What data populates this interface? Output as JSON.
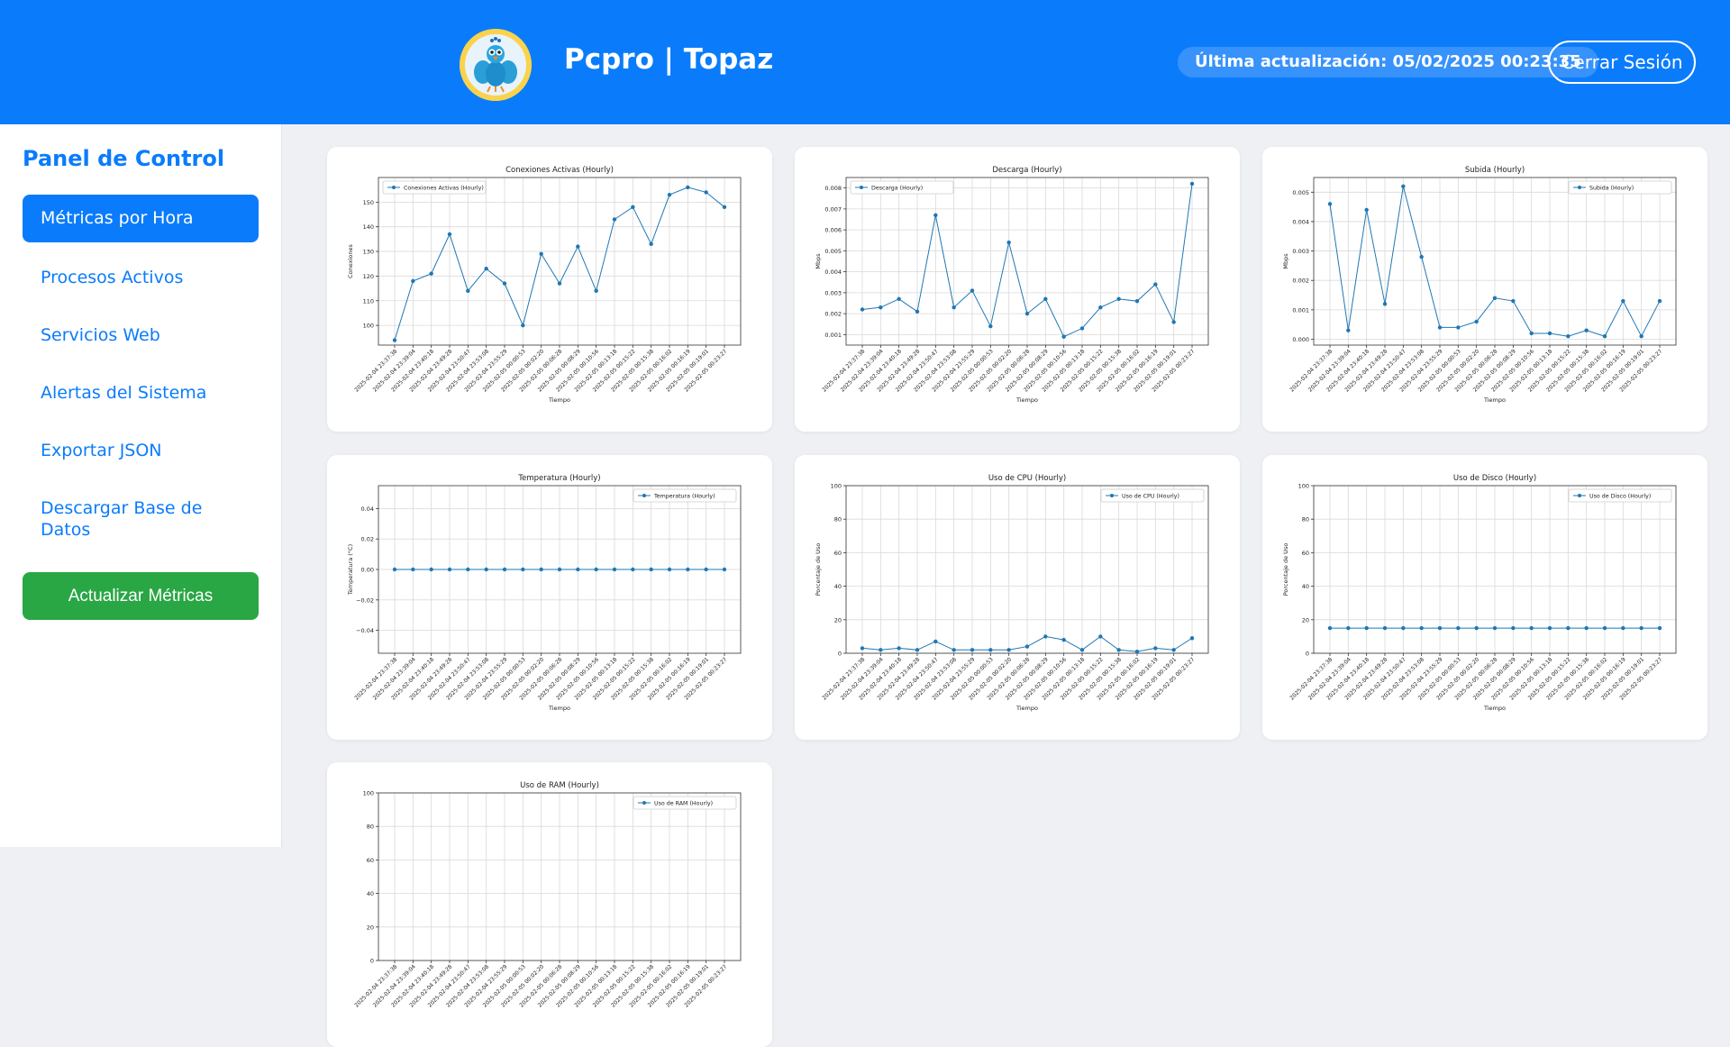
{
  "header": {
    "brand": "Pcpro | Topaz",
    "last_updated": "Última actualización: 05/02/2025 00:23:35",
    "logout_label": "Cerrar Sesión"
  },
  "sidebar": {
    "title": "Panel de Control",
    "items": [
      {
        "label": "Métricas por Hora"
      },
      {
        "label": "Procesos Activos"
      },
      {
        "label": "Servicios Web"
      },
      {
        "label": "Alertas del Sistema"
      },
      {
        "label": "Exportar JSON"
      },
      {
        "label": "Descargar Base de Datos"
      }
    ],
    "refresh_label": "Actualizar Métricas"
  },
  "colors": {
    "primary": "#0a7cfb",
    "success": "#29a744",
    "line": "#1f77b4"
  },
  "chart_data": [
    {
      "type": "line",
      "title": "Conexiones Activas (Hourly)",
      "xlabel": "Tiempo",
      "ylabel": "Conexiones",
      "legend": "top-left",
      "grid": true,
      "ylim": [
        92,
        160
      ],
      "yticks": [
        "100",
        "110",
        "120",
        "130",
        "140",
        "150"
      ],
      "x": [
        "2025-02-04 23:37:38",
        "2025-02-04 23:39:04",
        "2025-02-04 23:40:18",
        "2025-02-04 23:49:28",
        "2025-02-04 23:50:47",
        "2025-02-04 23:53:08",
        "2025-02-04 23:55:29",
        "2025-02-05 00:00:53",
        "2025-02-05 00:02:20",
        "2025-02-05 00:06:28",
        "2025-02-05 00:08:29",
        "2025-02-05 00:10:56",
        "2025-02-05 00:13:18",
        "2025-02-05 00:15:22",
        "2025-02-05 00:15:38",
        "2025-02-05 00:16:02",
        "2025-02-05 00:16:19",
        "2025-02-05 00:19:01",
        "2025-02-05 00:23:27"
      ],
      "series": [
        {
          "name": "Conexiones Activas (Hourly)",
          "values": [
            94,
            118,
            121,
            137,
            114,
            123,
            117,
            100,
            129,
            117,
            132,
            114,
            143,
            148,
            133,
            153,
            156,
            154,
            148
          ]
        }
      ]
    },
    {
      "type": "line",
      "title": "Descarga (Hourly)",
      "xlabel": "Tiempo",
      "ylabel": "Mbps",
      "legend": "top-left",
      "grid": true,
      "ylim": [
        0.0005,
        0.0085
      ],
      "yticks": [
        "0.001",
        "0.002",
        "0.003",
        "0.004",
        "0.005",
        "0.006",
        "0.007",
        "0.008"
      ],
      "x": [
        "2025-02-04 23:37:38",
        "2025-02-04 23:39:04",
        "2025-02-04 23:40:18",
        "2025-02-04 23:49:28",
        "2025-02-04 23:50:47",
        "2025-02-04 23:53:08",
        "2025-02-04 23:55:29",
        "2025-02-05 00:00:53",
        "2025-02-05 00:02:20",
        "2025-02-05 00:06:28",
        "2025-02-05 00:08:29",
        "2025-02-05 00:10:56",
        "2025-02-05 00:13:18",
        "2025-02-05 00:15:22",
        "2025-02-05 00:15:38",
        "2025-02-05 00:16:02",
        "2025-02-05 00:16:19",
        "2025-02-05 00:19:01",
        "2025-02-05 00:23:27"
      ],
      "series": [
        {
          "name": "Descarga (Hourly)",
          "values": [
            0.0022,
            0.0023,
            0.0027,
            0.0021,
            0.0067,
            0.0023,
            0.0031,
            0.0014,
            0.0054,
            0.002,
            0.0027,
            0.0009,
            0.0013,
            0.0023,
            0.0027,
            0.0026,
            0.0034,
            0.0016,
            0.0082
          ]
        }
      ]
    },
    {
      "type": "line",
      "title": "Subida (Hourly)",
      "xlabel": "Tiempo",
      "ylabel": "Mbps",
      "legend": "top-right",
      "grid": true,
      "ylim": [
        -0.0002,
        0.0055
      ],
      "yticks": [
        "0.000",
        "0.001",
        "0.002",
        "0.003",
        "0.004",
        "0.005"
      ],
      "x": [
        "2025-02-04 23:37:38",
        "2025-02-04 23:39:04",
        "2025-02-04 23:40:18",
        "2025-02-04 23:49:28",
        "2025-02-04 23:50:47",
        "2025-02-04 23:53:08",
        "2025-02-04 23:55:29",
        "2025-02-05 00:00:53",
        "2025-02-05 00:02:20",
        "2025-02-05 00:06:28",
        "2025-02-05 00:08:29",
        "2025-02-05 00:10:56",
        "2025-02-05 00:13:18",
        "2025-02-05 00:15:22",
        "2025-02-05 00:15:38",
        "2025-02-05 00:16:02",
        "2025-02-05 00:16:19",
        "2025-02-05 00:19:01",
        "2025-02-05 00:23:27"
      ],
      "series": [
        {
          "name": "Subida (Hourly)",
          "values": [
            0.0046,
            0.0003,
            0.0044,
            0.0012,
            0.0052,
            0.0028,
            0.0004,
            0.0004,
            0.0006,
            0.0014,
            0.0013,
            0.0002,
            0.0002,
            0.0001,
            0.0003,
            0.0001,
            0.0013,
            0.0001,
            0.0013
          ]
        }
      ]
    },
    {
      "type": "line",
      "title": "Temperatura (Hourly)",
      "xlabel": "Tiempo",
      "ylabel": "Temperatura (°C)",
      "legend": "top-right",
      "grid": true,
      "ylim": [
        -0.055,
        0.055
      ],
      "yticks": [
        "−0.04",
        "−0.02",
        "0.00",
        "0.02",
        "0.04"
      ],
      "x": [
        "2025-02-04 23:37:38",
        "2025-02-04 23:39:04",
        "2025-02-04 23:40:18",
        "2025-02-04 23:49:28",
        "2025-02-04 23:50:47",
        "2025-02-04 23:53:08",
        "2025-02-04 23:55:29",
        "2025-02-05 00:00:53",
        "2025-02-05 00:02:20",
        "2025-02-05 00:06:28",
        "2025-02-05 00:08:29",
        "2025-02-05 00:10:56",
        "2025-02-05 00:13:18",
        "2025-02-05 00:15:22",
        "2025-02-05 00:15:38",
        "2025-02-05 00:16:02",
        "2025-02-05 00:16:19",
        "2025-02-05 00:19:01",
        "2025-02-05 00:23:27"
      ],
      "series": [
        {
          "name": "Temperatura (Hourly)",
          "values": [
            0,
            0,
            0,
            0,
            0,
            0,
            0,
            0,
            0,
            0,
            0,
            0,
            0,
            0,
            0,
            0,
            0,
            0,
            0
          ]
        }
      ]
    },
    {
      "type": "line",
      "title": "Uso de CPU (Hourly)",
      "xlabel": "Tiempo",
      "ylabel": "Porcentaje de Uso",
      "legend": "top-right",
      "grid": true,
      "ylim": [
        0,
        100
      ],
      "yticks": [
        "0",
        "20",
        "40",
        "60",
        "80",
        "100"
      ],
      "x": [
        "2025-02-04 23:37:38",
        "2025-02-04 23:39:04",
        "2025-02-04 23:40:18",
        "2025-02-04 23:49:28",
        "2025-02-04 23:50:47",
        "2025-02-04 23:53:08",
        "2025-02-04 23:55:29",
        "2025-02-05 00:00:53",
        "2025-02-05 00:02:20",
        "2025-02-05 00:06:28",
        "2025-02-05 00:08:29",
        "2025-02-05 00:10:56",
        "2025-02-05 00:13:18",
        "2025-02-05 00:15:22",
        "2025-02-05 00:15:38",
        "2025-02-05 00:16:02",
        "2025-02-05 00:16:19",
        "2025-02-05 00:19:01",
        "2025-02-05 00:23:27"
      ],
      "series": [
        {
          "name": "Uso de CPU (Hourly)",
          "values": [
            3,
            2,
            3,
            2,
            7,
            2,
            2,
            2,
            2,
            4,
            10,
            8,
            2,
            10,
            2,
            1,
            3,
            2,
            9
          ]
        }
      ]
    },
    {
      "type": "line",
      "title": "Uso de Disco (Hourly)",
      "xlabel": "Tiempo",
      "ylabel": "Porcentaje de Uso",
      "legend": "top-right",
      "grid": true,
      "ylim": [
        0,
        100
      ],
      "yticks": [
        "0",
        "20",
        "40",
        "60",
        "80",
        "100"
      ],
      "x": [
        "2025-02-04 23:37:38",
        "2025-02-04 23:39:04",
        "2025-02-04 23:40:18",
        "2025-02-04 23:49:28",
        "2025-02-04 23:50:47",
        "2025-02-04 23:53:08",
        "2025-02-04 23:55:29",
        "2025-02-05 00:00:53",
        "2025-02-05 00:02:20",
        "2025-02-05 00:06:28",
        "2025-02-05 00:08:29",
        "2025-02-05 00:10:56",
        "2025-02-05 00:13:18",
        "2025-02-05 00:15:22",
        "2025-02-05 00:15:38",
        "2025-02-05 00:16:02",
        "2025-02-05 00:16:19",
        "2025-02-05 00:19:01",
        "2025-02-05 00:23:27"
      ],
      "series": [
        {
          "name": "Uso de Disco (Hourly)",
          "values": [
            15,
            15,
            15,
            15,
            15,
            15,
            15,
            15,
            15,
            15,
            15,
            15,
            15,
            15,
            15,
            15,
            15,
            15,
            15
          ]
        }
      ]
    },
    {
      "type": "line",
      "title": "Uso de RAM (Hourly)",
      "xlabel": "",
      "ylabel": "",
      "legend": "top-right",
      "grid": true,
      "ylim": [
        0,
        100
      ],
      "yticks": [
        "0",
        "20",
        "40",
        "60",
        "80",
        "100"
      ],
      "x": [
        "2025-02-04 23:37:38",
        "2025-02-04 23:39:04",
        "2025-02-04 23:40:18",
        "2025-02-04 23:49:28",
        "2025-02-04 23:50:47",
        "2025-02-04 23:53:08",
        "2025-02-04 23:55:29",
        "2025-02-05 00:00:53",
        "2025-02-05 00:02:20",
        "2025-02-05 00:06:28",
        "2025-02-05 00:08:29",
        "2025-02-05 00:10:56",
        "2025-02-05 00:13:18",
        "2025-02-05 00:15:22",
        "2025-02-05 00:15:38",
        "2025-02-05 00:16:02",
        "2025-02-05 00:16:19",
        "2025-02-05 00:19:01",
        "2025-02-05 00:23:27"
      ],
      "series": [
        {
          "name": "Uso de RAM (Hourly)",
          "values": []
        }
      ]
    }
  ]
}
